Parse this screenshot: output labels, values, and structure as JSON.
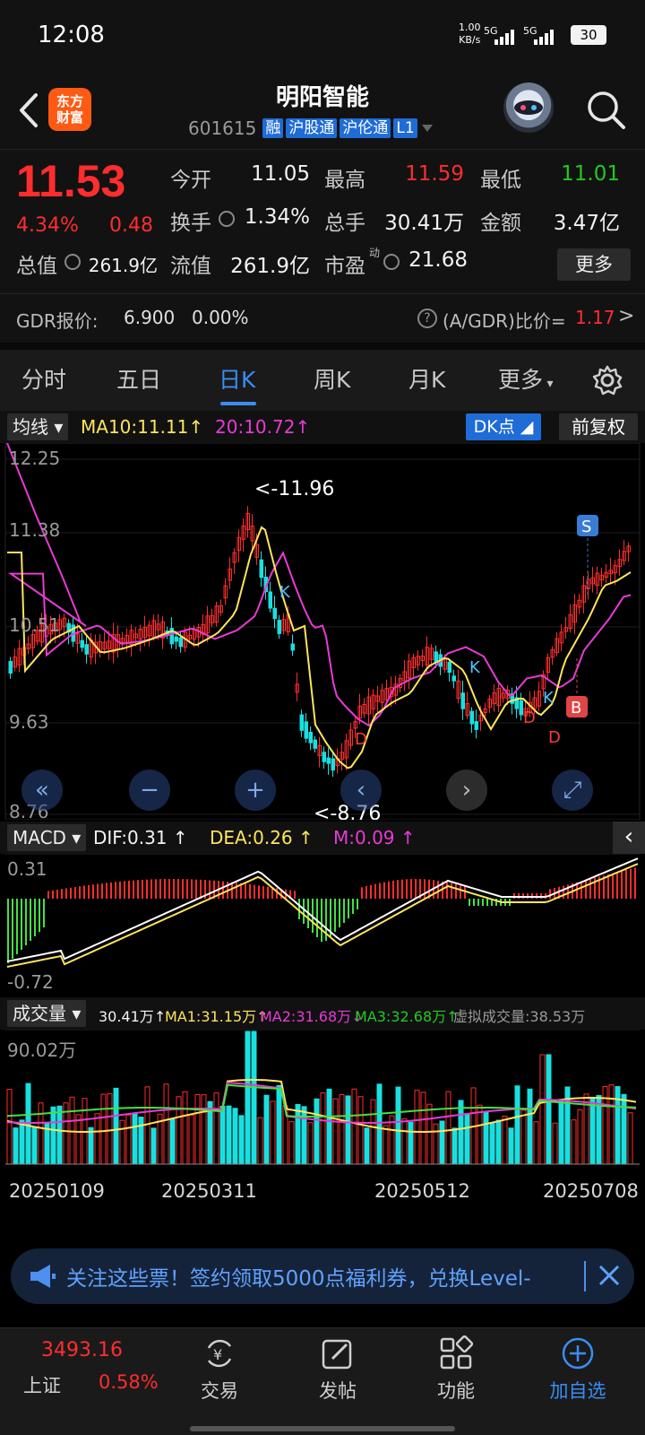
{
  "status_bar": {
    "time": "12:08",
    "speed_value": "1.00",
    "speed_unit": "KB/s",
    "signal1": "5G",
    "signal2": "5G",
    "battery": "30"
  },
  "header": {
    "logo_line1": "东方",
    "logo_line2": "财富",
    "stock_name": "明阳智能",
    "stock_code": "601615",
    "tags": [
      "融",
      "沪股通",
      "沪伦通",
      "L1"
    ]
  },
  "quote": {
    "price": "11.53",
    "change_pct": "4.34%",
    "change": "0.48",
    "open_label": "今开",
    "open": "11.05",
    "high_label": "最高",
    "high": "11.59",
    "low_label": "最低",
    "low": "11.01",
    "turnover_label": "换手",
    "turnover": "1.34%",
    "volume_label": "总手",
    "volume": "30.41万",
    "amount_label": "金额",
    "amount": "3.47亿",
    "mktcap_label": "总值",
    "mktcap": "261.9亿",
    "float_label": "流值",
    "float": "261.9亿",
    "pe_label": "市盈",
    "pe_sup": "动",
    "pe": "21.68",
    "more": "更多",
    "gdr_label": "GDR报价:",
    "gdr_value": "6.900",
    "gdr_pct": "0.00%",
    "gdr_ratio_label": "(A/GDR)比价=",
    "gdr_ratio": "1.17",
    "gdr_arrow": ">"
  },
  "tabs": [
    "分时",
    "五日",
    "日K",
    "周K",
    "月K",
    "更多"
  ],
  "active_tab": "日K",
  "kline": {
    "ma_dropdown": "均线",
    "ma10_label": "MA10:11.11",
    "ma20_label": "20:10.72",
    "up_arrow": "↑",
    "dk_button": "DK点",
    "restore_button": "前复权",
    "y_labels": [
      "12.25",
      "11.38",
      "10.51",
      "9.63",
      "8.76"
    ],
    "max_annotation": "<-11.96",
    "min_annotation": "<-8.76",
    "markers": {
      "K": "K",
      "D": "D",
      "S": "S",
      "B": "B"
    }
  },
  "macd": {
    "dropdown": "MACD",
    "dif": "DIF:0.31",
    "dea": "DEA:0.26",
    "m": "M:0.09",
    "y_top": "0.31",
    "y_bottom": "-0.72"
  },
  "volume": {
    "dropdown": "成交量",
    "vol": "30.41万",
    "ma1": "MA1:31.15万",
    "ma2": "MA2:31.68万",
    "ma3": "MA3:32.68万",
    "virtual": "虚拟成交量:38.53万",
    "y_top": "90.02万",
    "up": "↑",
    "down": "↓"
  },
  "dates": [
    "20250109",
    "20250311",
    "20250512",
    "20250708"
  ],
  "promo": {
    "text": "关注这些票！签约领取5000点福利券，兑换Level-"
  },
  "bottom_nav": {
    "index_value": "3493.16",
    "index_name": "上证",
    "index_pct": "0.58%",
    "items": [
      "交易",
      "发帖",
      "功能",
      "加自选"
    ]
  },
  "colors": {
    "up": "#ff2d2d",
    "down": "#22c922",
    "accent": "#3a8df5",
    "ma10": "#ffe45c",
    "ma20": "#e83ad6"
  }
}
